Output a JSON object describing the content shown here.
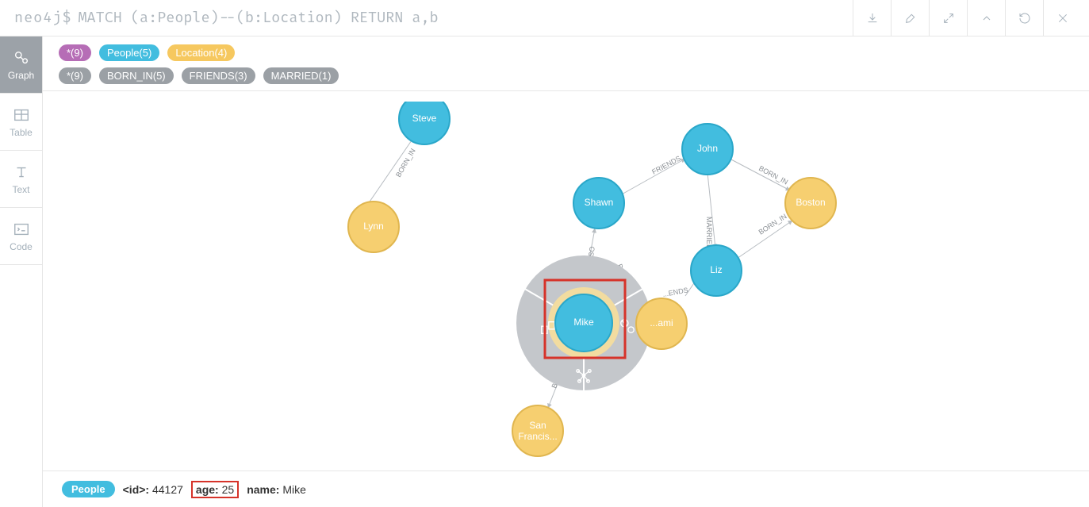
{
  "prompt": "neo4j$",
  "query": "MATCH (a:People)--(b:Location) RETURN a,b",
  "sideTabs": {
    "graph": "Graph",
    "table": "Table",
    "text": "Text",
    "code": "Code"
  },
  "labelTags": {
    "star": "*(9)",
    "people": "People(5)",
    "location": "Location(4)"
  },
  "relTags": {
    "star": "*(9)",
    "born": "BORN_IN(5)",
    "friends": "FRIENDS(3)",
    "married": "MARRIED(1)"
  },
  "nodes": {
    "steve": "Steve",
    "lynn": "Lynn",
    "shawn": "Shawn",
    "john": "John",
    "boston": "Boston",
    "liz": "Liz",
    "mike": "Mike",
    "miami": "...ami",
    "sf1": "San",
    "sf2": "Francis..."
  },
  "edges": {
    "born": "BORN_IN",
    "friends": "FRIENDS",
    "married": "MARRIED",
    "so": "SO",
    "bo": "BO"
  },
  "footer": {
    "label": "People",
    "idKey": "<id>:",
    "idVal": "44127",
    "ageKey": "age:",
    "ageVal": "25",
    "nameKey": "name:",
    "nameVal": "Mike"
  }
}
